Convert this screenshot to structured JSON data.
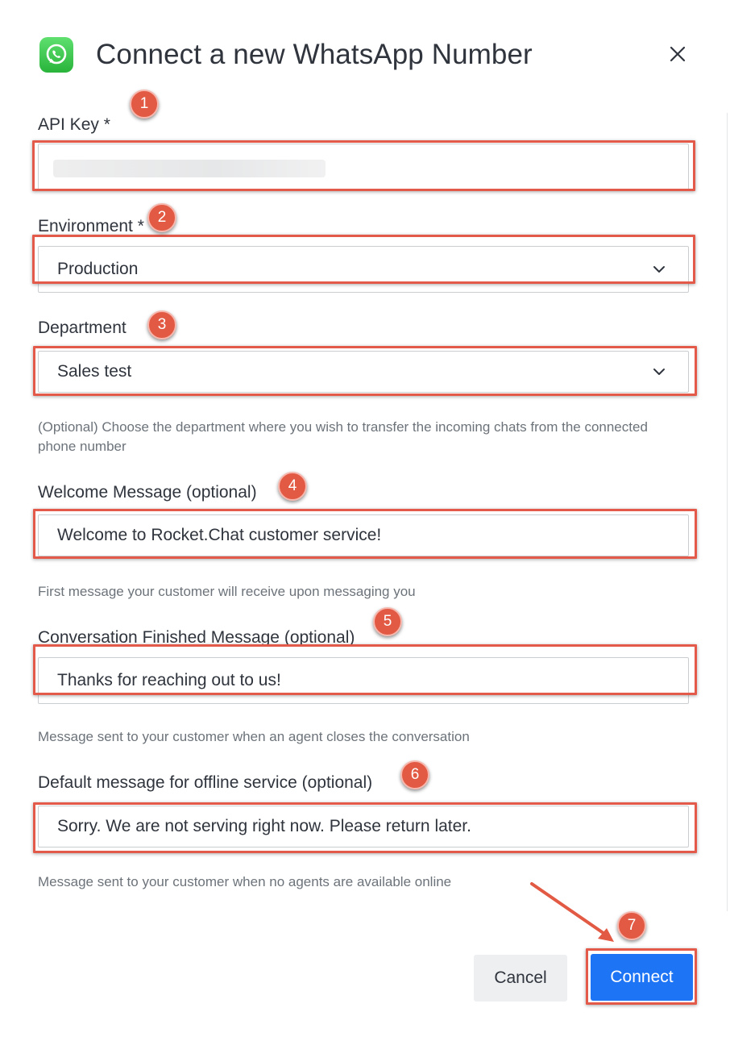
{
  "dialog": {
    "title": "Connect a new WhatsApp Number",
    "close_icon": "close-icon",
    "logo_icon": "whatsapp-logo-icon"
  },
  "fields": {
    "api_key": {
      "label": "API Key *",
      "value": ""
    },
    "environment": {
      "label": "Environment *",
      "value": "Production"
    },
    "department": {
      "label": "Department",
      "value": "Sales test",
      "hint": "(Optional) Choose the department where you wish to transfer the incoming chats from the connected phone number"
    },
    "welcome_message": {
      "label": "Welcome Message (optional)",
      "value": "Welcome to Rocket.Chat customer service!",
      "hint": "First message your customer will receive upon messaging you"
    },
    "finished_message": {
      "label": "Conversation Finished Message (optional)",
      "value": "Thanks for reaching out to us!",
      "hint": "Message sent to your customer when an agent closes the conversation"
    },
    "offline_message": {
      "label": "Default message for offline service (optional)",
      "value": "Sorry. We are not serving right now. Please return later.",
      "hint": "Message sent to your customer when no agents are available online"
    }
  },
  "buttons": {
    "cancel": "Cancel",
    "connect": "Connect"
  },
  "annotations": {
    "step_1": "1",
    "step_2": "2",
    "step_3": "3",
    "step_4": "4",
    "step_5": "5",
    "step_6": "6",
    "step_7": "7",
    "annotation_color": "#e25a43"
  },
  "colors": {
    "primary": "#1d74f5",
    "whatsapp_green": "#29b43b",
    "text": "#2f343d",
    "hint": "#6c737a"
  }
}
